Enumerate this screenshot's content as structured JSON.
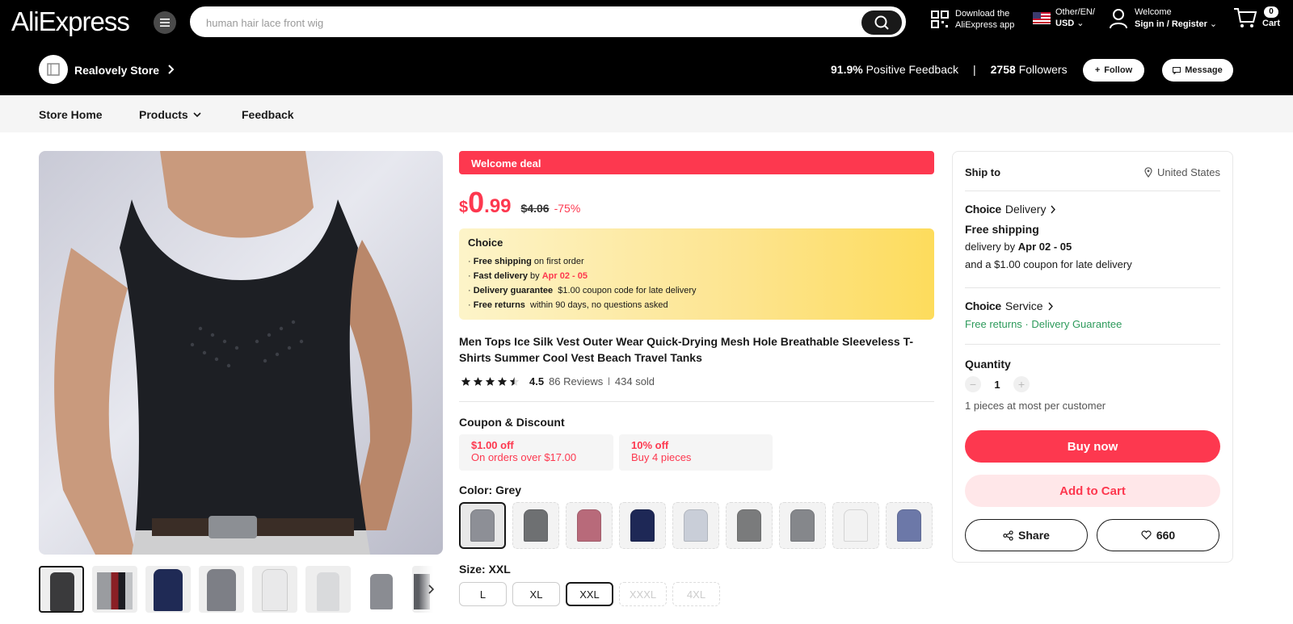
{
  "header": {
    "logo": "AliExpress",
    "search_placeholder": "human hair lace front wig",
    "download_line1": "Download the",
    "download_line2": "AliExpress app",
    "lang_line1": "Other/EN/",
    "lang_line2": "USD",
    "account_line1": "Welcome",
    "account_line2": "Sign in / Register",
    "cart_count": "0",
    "cart_label": "Cart"
  },
  "store": {
    "name": "Realovely Store",
    "feedback_value": "91.9%",
    "feedback_label": "Positive Feedback",
    "separator": "|",
    "followers_value": "2758",
    "followers_label": "Followers",
    "follow_label": "Follow",
    "message_label": "Message"
  },
  "store_nav": {
    "home": "Store Home",
    "products": "Products",
    "feedback": "Feedback"
  },
  "product": {
    "welcome_deal": "Welcome deal",
    "price_currency": "$",
    "price_int": "0",
    "price_dec": ".99",
    "old_price": "$4.06",
    "discount": "-75%",
    "choice": {
      "title": "Choice",
      "bullet": "·",
      "l1_b": "Free shipping",
      "l1_t": " on first order",
      "l2_b": "Fast delivery",
      "l2_t": " by ",
      "l2_r": "Apr 02 - 05",
      "l3_b": "Delivery guarantee",
      "l3_t": "  $1.00 coupon code for late delivery",
      "l4_b": "Free returns",
      "l4_t": "  within 90 days, no questions asked"
    },
    "title": "Men Tops Ice Silk Vest Outer Wear Quick-Drying Mesh Hole Breathable Sleeveless T-Shirts Summer Cool Vest Beach Travel Tanks",
    "rating": "4.5",
    "reviews": "86 Reviews",
    "rating_sep": "|",
    "sold": "434 sold",
    "coupon_title": "Coupon & Discount",
    "coupons": [
      {
        "value": "$1.00 off",
        "condition": "On orders over $17.00"
      },
      {
        "value": "10% off",
        "condition": "Buy 4 pieces"
      }
    ],
    "color_label": "Color: Grey",
    "color_swatches": [
      "#8d8f96",
      "#6e7072",
      "#b86a7a",
      "#1e2856",
      "#c9ced8",
      "#7a7b7c",
      "#85878b",
      "#f2f2f2",
      "#6c78a8"
    ],
    "size_label": "Size: XXL",
    "sizes": [
      "L",
      "XL",
      "XXL",
      "XXXL",
      "4XL"
    ],
    "thumb_colors": [
      "#3a3a3c",
      "#9a9ca0",
      "#1f2a55",
      "#7d7f86",
      "#e9e9ea",
      "#d9dadc",
      "#8a8c92",
      "#5b5d62"
    ]
  },
  "side": {
    "ship_to": "Ship to",
    "country": "United States",
    "choice_word": "Choice",
    "delivery_word": "Delivery",
    "free_shipping": "Free shipping",
    "delivery_by": "delivery by ",
    "delivery_dates": "Apr 02 - 05",
    "late_coupon": "and a $1.00 coupon for late delivery",
    "service_word": "Service",
    "free_returns": "Free returns",
    "dot": " · ",
    "delivery_guarantee": "Delivery Guarantee",
    "quantity_label": "Quantity",
    "qty_minus": "−",
    "quantity": "1",
    "qty_plus": "+",
    "limit": "1 pieces at most per customer",
    "buy_now": "Buy now",
    "add_to_cart": "Add to Cart",
    "share": "Share",
    "wishlist_count": "660"
  },
  "colors": {
    "brand_red": "#fd384f",
    "green": "#2d9a5b",
    "topbar": "#000000"
  }
}
